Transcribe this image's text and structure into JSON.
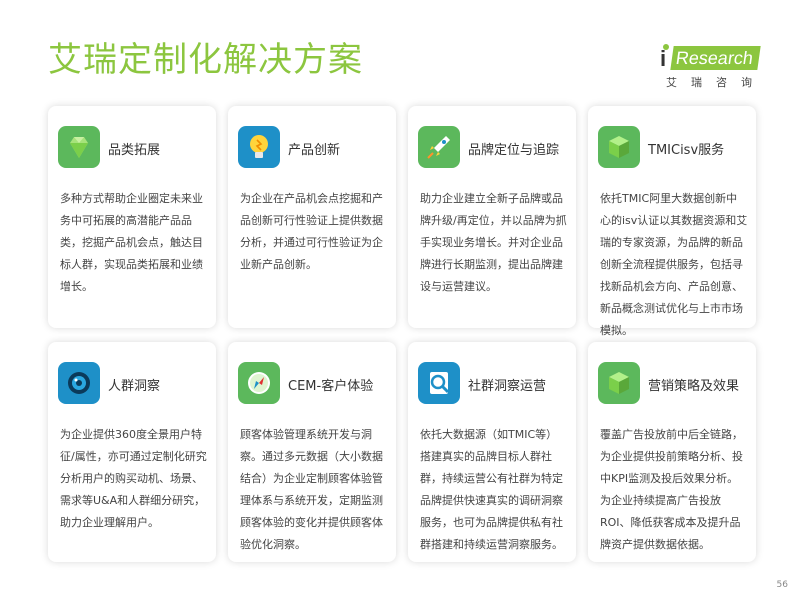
{
  "title": "艾瑞定制化解决方案",
  "logo": {
    "prefix": "i",
    "word": "Research",
    "sub": "艾瑞咨询"
  },
  "colors": {
    "accent": "#8cc63f",
    "icon_green": "#5cb85c",
    "icon_blue": "#1e90c8"
  },
  "cards": [
    {
      "title": "品类拓展",
      "icon": "gem-icon",
      "body": "多种方式帮助企业圈定未来业务中可拓展的高潜能产品品类，挖掘产品机会点，触达目标人群，实现品类拓展和业绩增长。"
    },
    {
      "title": "产品创新",
      "icon": "lightbulb-icon",
      "body": "为企业在产品机会点挖掘和产品创新可行性验证上提供数据分析，并通过可行性验证为企业新产品创新。"
    },
    {
      "title": "品牌定位与追踪",
      "icon": "rocket-icon",
      "body": "助力企业建立全新子品牌或品牌升级/再定位，并以品牌为抓手实现业务增长。并对企业品牌进行长期监测，提出品牌建设与运营建议。"
    },
    {
      "title": "TMICisv服务",
      "icon": "cube-icon",
      "body": "依托TMIC阿里大数据创新中心的isv认证以其数据资源和艾瑞的专家资源，为品牌的新品创新全流程提供服务，包括寻找新品机会方向、产品创意、新品概念测试优化与上市市场模拟。"
    },
    {
      "title": "人群洞察",
      "icon": "camera-lens-icon",
      "body": "为企业提供360度全景用户特征/属性，亦可通过定制化研究分析用户的购买动机、场景、需求等U&A和人群细分研究，助力企业理解用户。"
    },
    {
      "title": "CEM-客户体验",
      "icon": "compass-icon",
      "body": "顾客体验管理系统开发与洞察。通过多元数据（大小数据结合）为企业定制顾客体验管理体系与系统开发，定期监测顾客体验的变化并提供顾客体验优化洞察。"
    },
    {
      "title": "社群洞察运营",
      "icon": "magnifier-icon",
      "body": "依托大数据源（如TMIC等）搭建真实的品牌目标人群社群，持续运营公有社群为特定品牌提供快速真实的调研洞察服务，也可为品牌提供私有社群搭建和持续运营洞察服务。"
    },
    {
      "title": "营销策略及效果",
      "icon": "cube-icon",
      "body": "覆盖广告投放前中后全链路，为企业提供投前策略分析、投中KPI监测及投后效果分析。为企业持续提高广告投放ROI、降低获客成本及提升品牌资产提供数据依据。"
    }
  ],
  "page_number": "56"
}
